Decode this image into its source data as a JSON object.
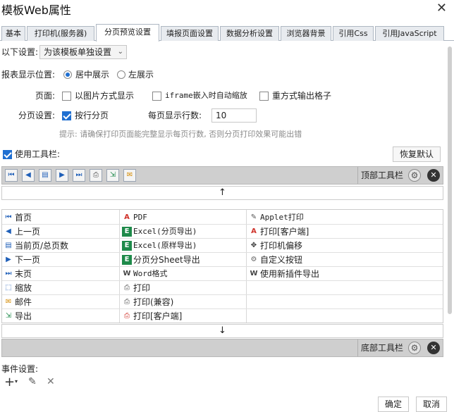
{
  "window": {
    "title": "模板Web属性"
  },
  "tabs": [
    {
      "label": "基本"
    },
    {
      "label": "打印机(服务器)"
    },
    {
      "label": "分页预览设置"
    },
    {
      "label": "填报页面设置"
    },
    {
      "label": "数据分析设置"
    },
    {
      "label": "浏览器背景"
    },
    {
      "label": "引用Css"
    },
    {
      "label": "引用JavaScript"
    }
  ],
  "settings": {
    "scope_label": "以下设置:",
    "scope_value": "为该模板单独设置",
    "position_label": "报表显示位置:",
    "position_center": "居中展示",
    "position_left": "左展示",
    "page_label": "页面:",
    "page_image": "以图片方式显示",
    "page_iframe": "iframe嵌入时自动缩放",
    "page_overlap": "重方式输出格子",
    "paging_label": "分页设置:",
    "paging_byrow": "按行分页",
    "rows_label": "每页显示行数:",
    "rows_value": "10",
    "hint": "提示: 请确保打印页面能完整显示每页行数, 否则分页打印效果可能出错"
  },
  "toolbar": {
    "use_label": "使用工具栏:",
    "reset_label": "恢复默认",
    "top_label": "顶部工具栏",
    "bottom_label": "底部工具栏",
    "up_arrow": "↑",
    "down_arrow": "↓"
  },
  "items": {
    "col1": [
      {
        "icon": "first-page-icon",
        "glyph": "⏮",
        "label": "首页"
      },
      {
        "icon": "prev-page-icon",
        "glyph": "◀",
        "label": "上一页"
      },
      {
        "icon": "page-count-icon",
        "glyph": "▤",
        "label": "当前页/总页数"
      },
      {
        "icon": "next-page-icon",
        "glyph": "▶",
        "label": "下一页"
      },
      {
        "icon": "last-page-icon",
        "glyph": "⏭",
        "label": "末页"
      },
      {
        "icon": "zoom-icon",
        "glyph": "⬚",
        "label": "缩放"
      },
      {
        "icon": "mail-icon",
        "glyph": "✉",
        "label": "邮件"
      },
      {
        "icon": "export-icon",
        "glyph": "⇲",
        "label": "导出"
      }
    ],
    "col2": [
      {
        "icon": "pdf-icon",
        "glyph": "A",
        "label": "PDF"
      },
      {
        "icon": "excel-page-icon",
        "glyph": "E",
        "label": "Excel(分页导出)"
      },
      {
        "icon": "excel-original-icon",
        "glyph": "E",
        "label": "Excel(原样导出)"
      },
      {
        "icon": "excel-sheet-icon",
        "glyph": "E",
        "label": "分页分Sheet导出"
      },
      {
        "icon": "word-icon",
        "glyph": "W",
        "label": "Word格式"
      },
      {
        "icon": "print-icon",
        "glyph": "⎙",
        "label": "打印"
      },
      {
        "icon": "print-compat-icon",
        "glyph": "⎙",
        "label": "打印(兼容)"
      },
      {
        "icon": "print-client-icon",
        "glyph": "⎙",
        "label": "打印[客户端]"
      }
    ],
    "col3": [
      {
        "icon": "applet-print-icon",
        "glyph": "✎",
        "label": "Applet打印"
      },
      {
        "icon": "pdf-print-client-icon",
        "glyph": "A",
        "label": "打印[客户端]"
      },
      {
        "icon": "printer-offset-icon",
        "glyph": "✥",
        "label": "打印机偏移"
      },
      {
        "icon": "custom-button-icon",
        "glyph": "⚙",
        "label": "自定义按钮"
      },
      {
        "icon": "new-plugin-export-icon",
        "glyph": "W",
        "label": "使用新插件导出"
      }
    ]
  },
  "events": {
    "label": "事件设置:"
  },
  "footer": {
    "ok": "确定",
    "cancel": "取消"
  },
  "colors": {
    "accent": "#1f6fd1",
    "pdf_red": "#d0342c",
    "excel_green": "#1e8a4a",
    "toolbar_gray": "#cfcfcf"
  }
}
